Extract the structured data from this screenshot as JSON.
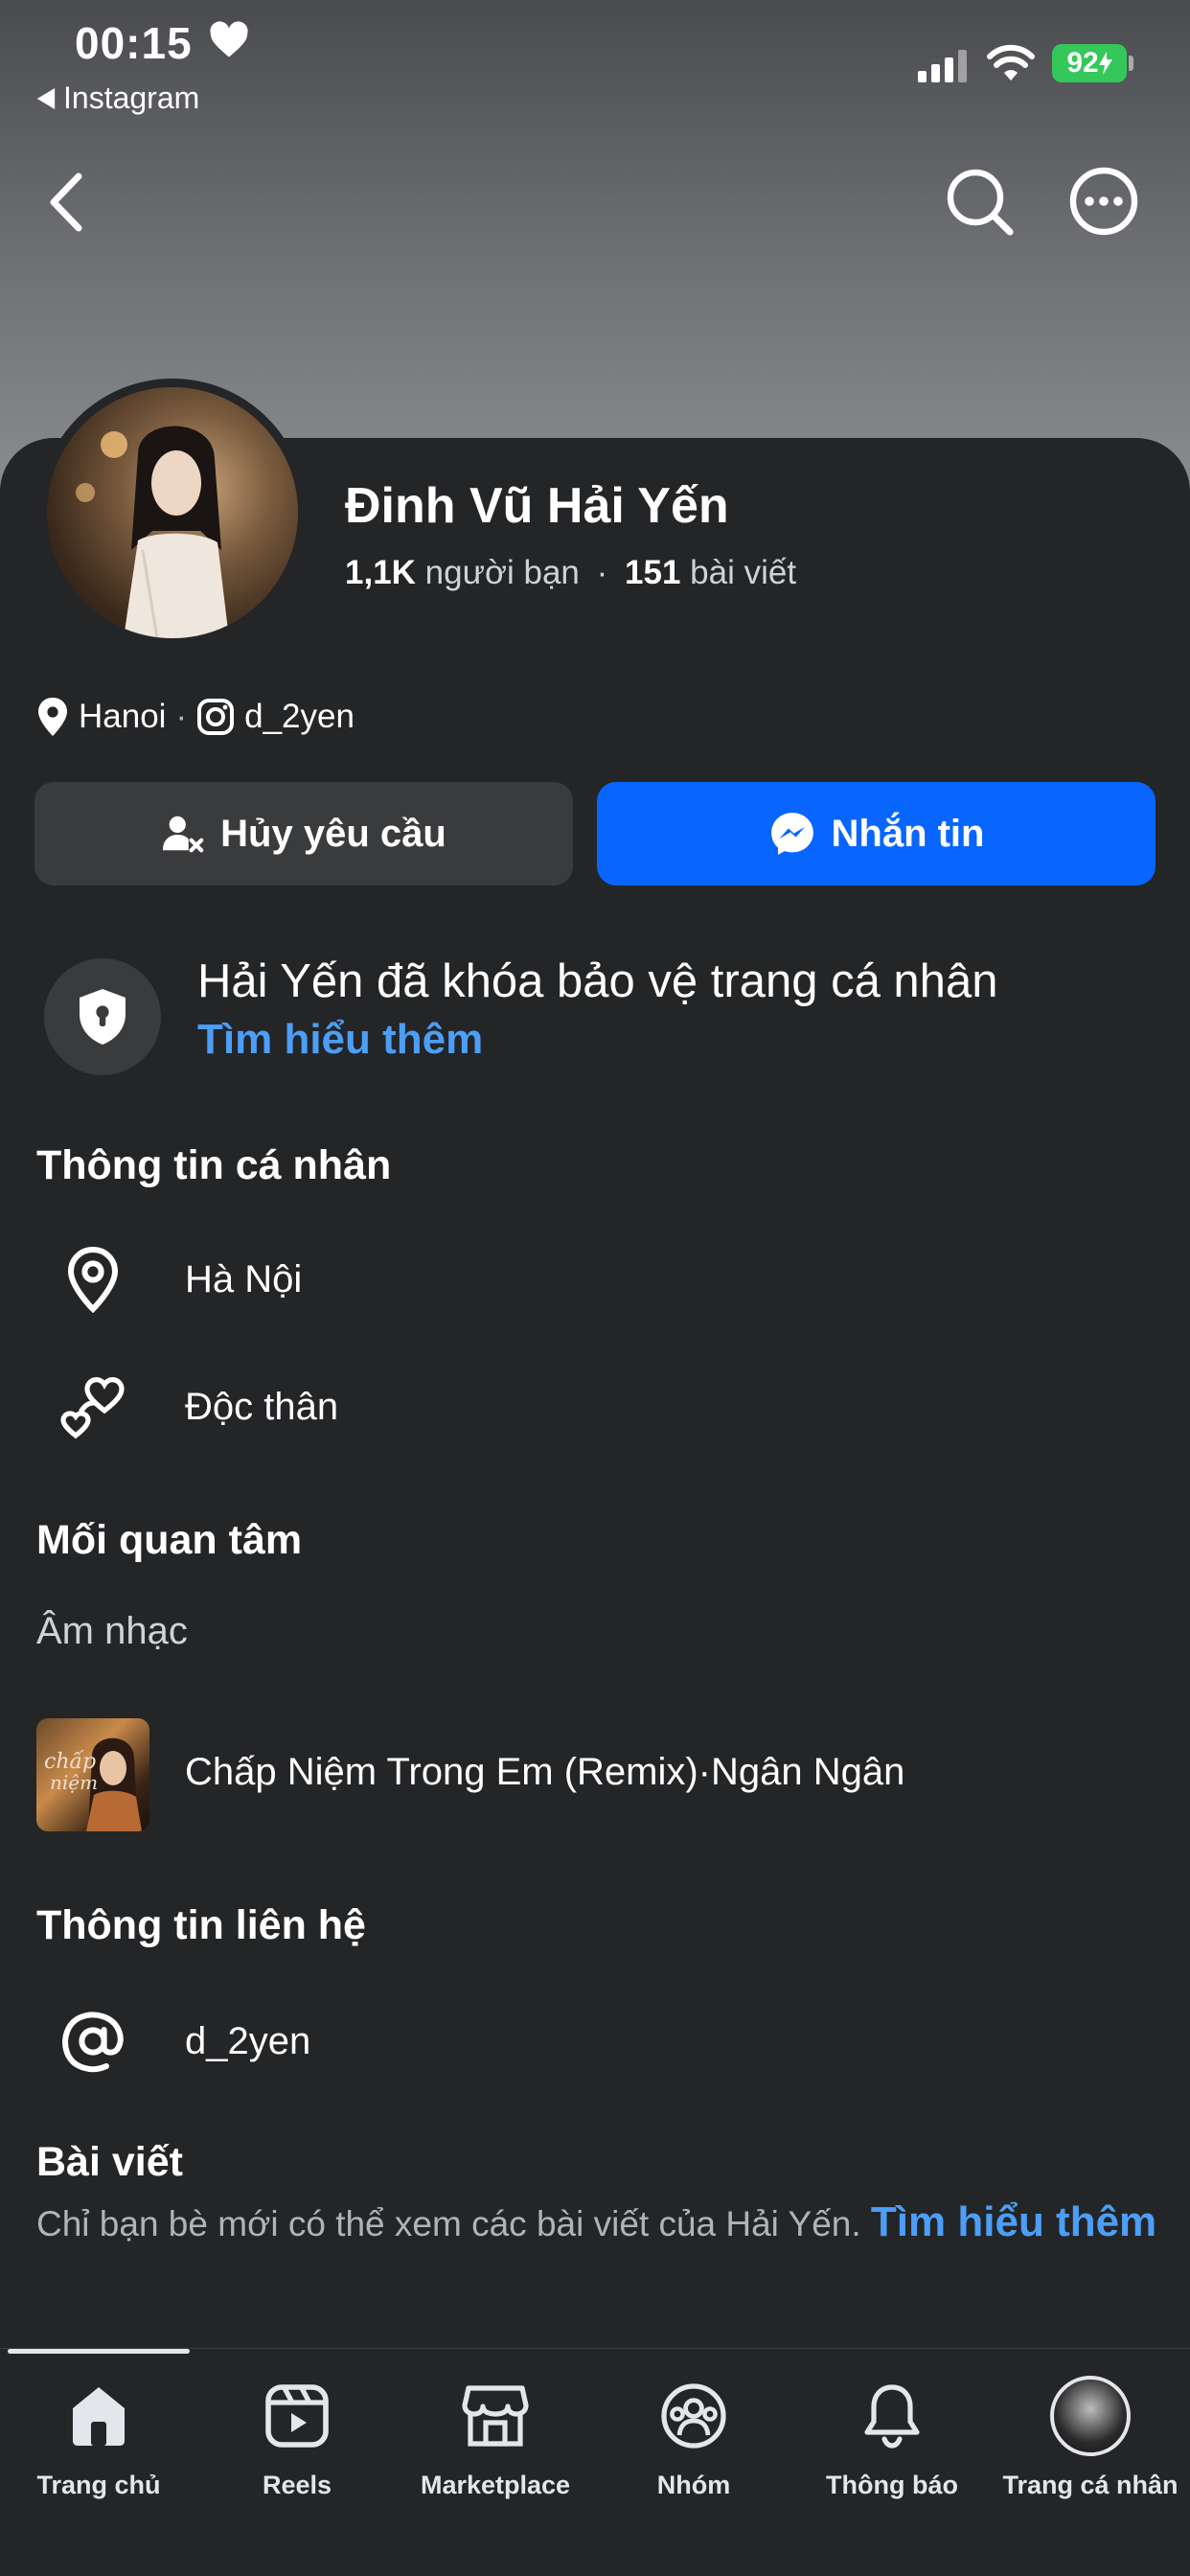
{
  "status_bar": {
    "time": "00:15",
    "back_app_label": "Instagram",
    "battery": "92"
  },
  "profile": {
    "name": "Đinh Vũ Hải Yến",
    "friends_count": "1,1K",
    "friends_label": "người bạn",
    "separator": "·",
    "posts_count": "151",
    "posts_label": "bài viết",
    "location_short": "Hanoi",
    "dot": "·",
    "instagram": "d_2yen"
  },
  "actions": {
    "cancel_request": "Hủy yêu cầu",
    "message": "Nhắn tin"
  },
  "lock_notice": {
    "text": "Hải Yến đã khóa bảo vệ trang cá nhân",
    "link": "Tìm hiểu thêm"
  },
  "personal_info": {
    "title": "Thông tin cá nhân",
    "location": "Hà Nội",
    "relationship": "Độc thân"
  },
  "interests": {
    "title": "Mối quan tâm",
    "category": "Âm nhạc",
    "song": "Chấp Niệm Trong Em (Remix)·Ngân Ngân"
  },
  "contact": {
    "title": "Thông tin liên hệ",
    "handle": "d_2yen"
  },
  "posts": {
    "title": "Bài viết",
    "description": "Chỉ bạn bè mới có thể xem các bài viết của Hải Yến.",
    "link": "Tìm hiểu thêm"
  },
  "tabbar": {
    "home": "Trang chủ",
    "reels": "Reels",
    "marketplace": "Marketplace",
    "groups": "Nhóm",
    "notifications": "Thông báo",
    "profile": "Trang cá nhân"
  },
  "colors": {
    "accent": "#0866ff",
    "link": "#4c9ef7",
    "background": "#242527",
    "button_secondary": "#3a3b3d",
    "battery": "#34c759"
  }
}
